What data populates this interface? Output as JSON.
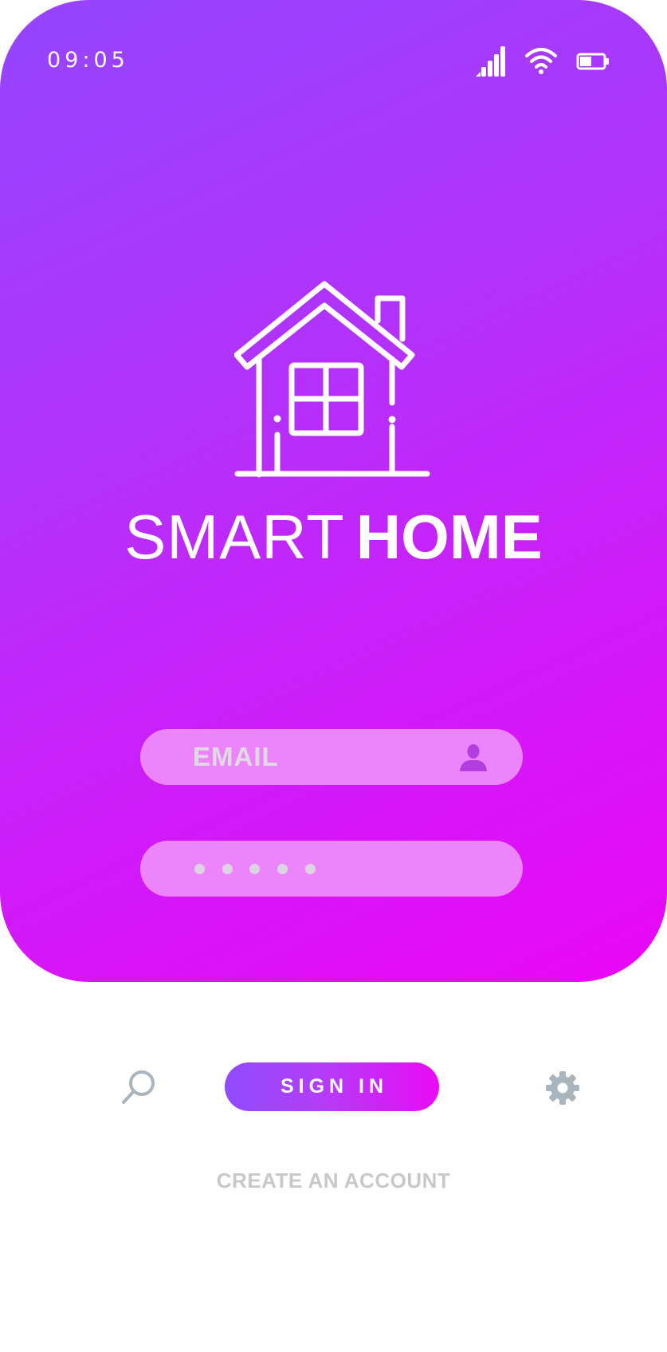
{
  "status_bar": {
    "time": "09:05",
    "icons": [
      "signal-icon",
      "wifi-icon",
      "battery-icon"
    ]
  },
  "brand": {
    "light": "SMART",
    "bold": "HOME",
    "logo_icon": "house-icon"
  },
  "form": {
    "email_placeholder": "EMAIL",
    "email_icon": "user-icon",
    "password_masked_dots": 5
  },
  "actions": {
    "search_icon": "search-icon",
    "sign_in_label": "SIGN IN",
    "settings_icon": "gear-icon",
    "create_account_label": "CREATE AN ACCOUNT"
  },
  "colors": {
    "gradient_start": "#9446ff",
    "gradient_end": "#ea06f6",
    "field_fill": "#ec85fb",
    "icon_gray": "#a9b4bd",
    "link_gray": "#c8c8c8"
  }
}
